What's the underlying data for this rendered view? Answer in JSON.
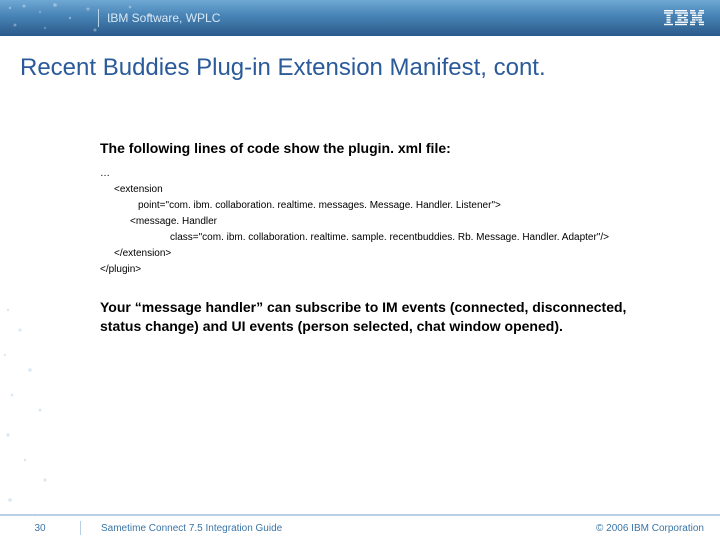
{
  "header": {
    "label": "IBM Software, WPLC",
    "logo_text": "IBM"
  },
  "slide": {
    "title": "Recent Buddies Plug-in Extension Manifest, cont."
  },
  "content": {
    "lead": "The following lines of code show the plugin. xml file:",
    "code": {
      "l1": "…",
      "l2": "<extension",
      "l3": "point=\"com. ibm. collaboration. realtime. messages. Message. Handler. Listener\">",
      "l4": "<message. Handler",
      "l5": "class=\"com. ibm. collaboration. realtime. sample. recentbuddies. Rb. Message. Handler. Adapter\"/>",
      "l6": "</extension>",
      "l7": "</plugin>"
    },
    "explain": "Your “message handler” can subscribe to IM events (connected, disconnected, status change) and UI events (person selected, chat window opened)."
  },
  "footer": {
    "page": "30",
    "title": "Sametime Connect 7.5 Integration Guide",
    "copyright": "© 2006 IBM Corporation"
  }
}
